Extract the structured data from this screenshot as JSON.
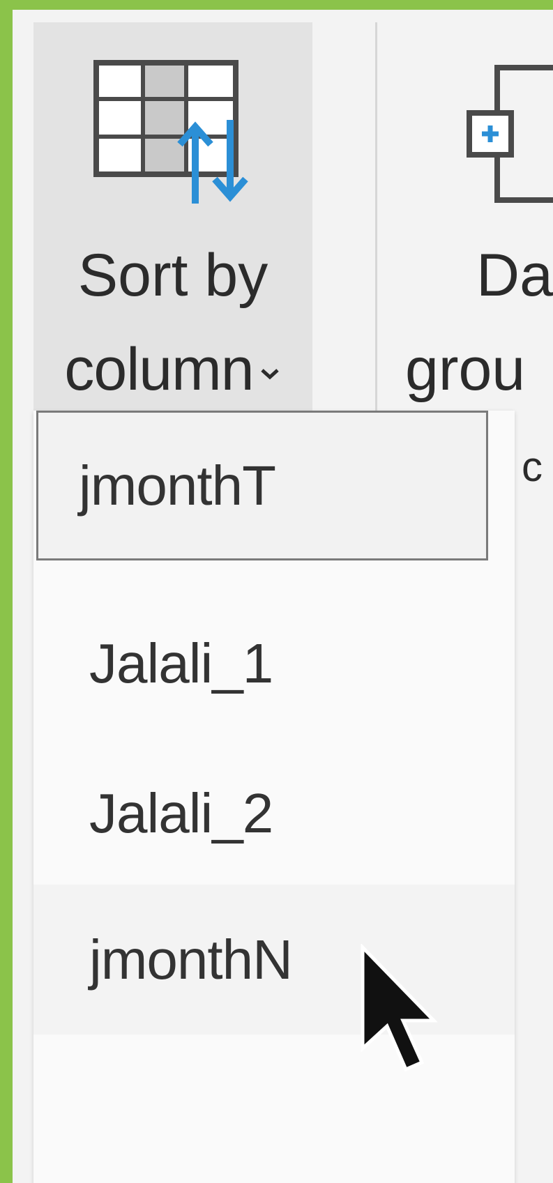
{
  "ribbon": {
    "sort_by_column": {
      "label_line1": "Sort by",
      "label_line2": "column",
      "icon": "sort-table-icon",
      "dropdown_icon": "chevron-down-icon"
    },
    "data_groups": {
      "label_line1": "Da",
      "label_line2": "grou",
      "label_line3": "c",
      "icon": "data-groups-icon"
    }
  },
  "dropdown": {
    "items": [
      {
        "label": "jmonthT",
        "state": "selected"
      },
      {
        "label": "Jalali_1",
        "state": "normal"
      },
      {
        "label": "Jalali_2",
        "state": "normal"
      },
      {
        "label": "jmonthN",
        "state": "hover"
      }
    ]
  },
  "colors": {
    "frame_border": "#8bc34a",
    "arrow_blue": "#2b8fd6",
    "button_bg": "#e3e3e3",
    "menu_bg": "#fafafa"
  }
}
